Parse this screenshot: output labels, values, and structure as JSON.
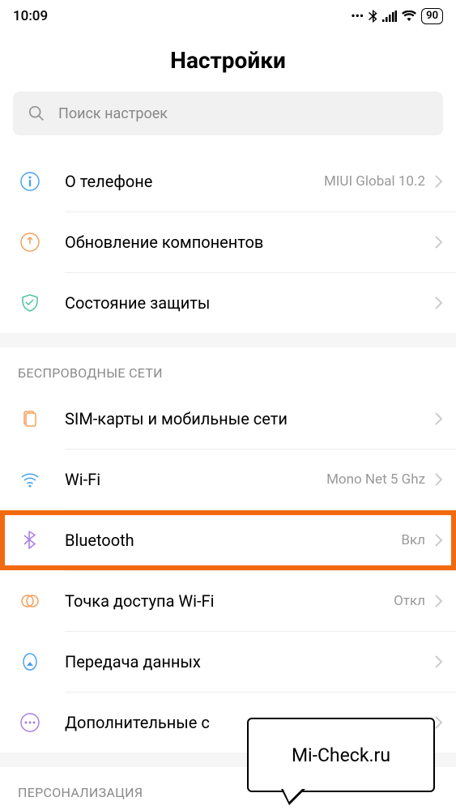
{
  "status_bar": {
    "time": "10:09",
    "battery": "90"
  },
  "header": {
    "title": "Настройки"
  },
  "search": {
    "placeholder": "Поиск настроек"
  },
  "section_top": [
    {
      "label": "О телефоне",
      "value": "MIUI Global 10.2",
      "icon": "info"
    },
    {
      "label": "Обновление компонентов",
      "value": "",
      "icon": "update"
    },
    {
      "label": "Состояние защиты",
      "value": "",
      "icon": "shield"
    }
  ],
  "sections": {
    "wireless": {
      "title": "БЕСПРОВОДНЫЕ СЕТИ",
      "items": [
        {
          "label": "SIM-карты и мобильные сети",
          "value": "",
          "icon": "sim"
        },
        {
          "label": "Wi-Fi",
          "value": "Mono Net 5 Ghz",
          "icon": "wifi"
        },
        {
          "label": "Bluetooth",
          "value": "Вкл",
          "icon": "bluetooth",
          "highlight": true
        },
        {
          "label": "Точка доступа Wi-Fi",
          "value": "Откл",
          "icon": "hotspot"
        },
        {
          "label": "Передача данных",
          "value": "",
          "icon": "data"
        },
        {
          "label": "Дополнительные с",
          "value": "",
          "icon": "more"
        }
      ]
    },
    "personalization": {
      "title": "ПЕРСОНАЛИЗАЦИЯ"
    }
  },
  "speech_bubble": "Mi-Check.ru"
}
